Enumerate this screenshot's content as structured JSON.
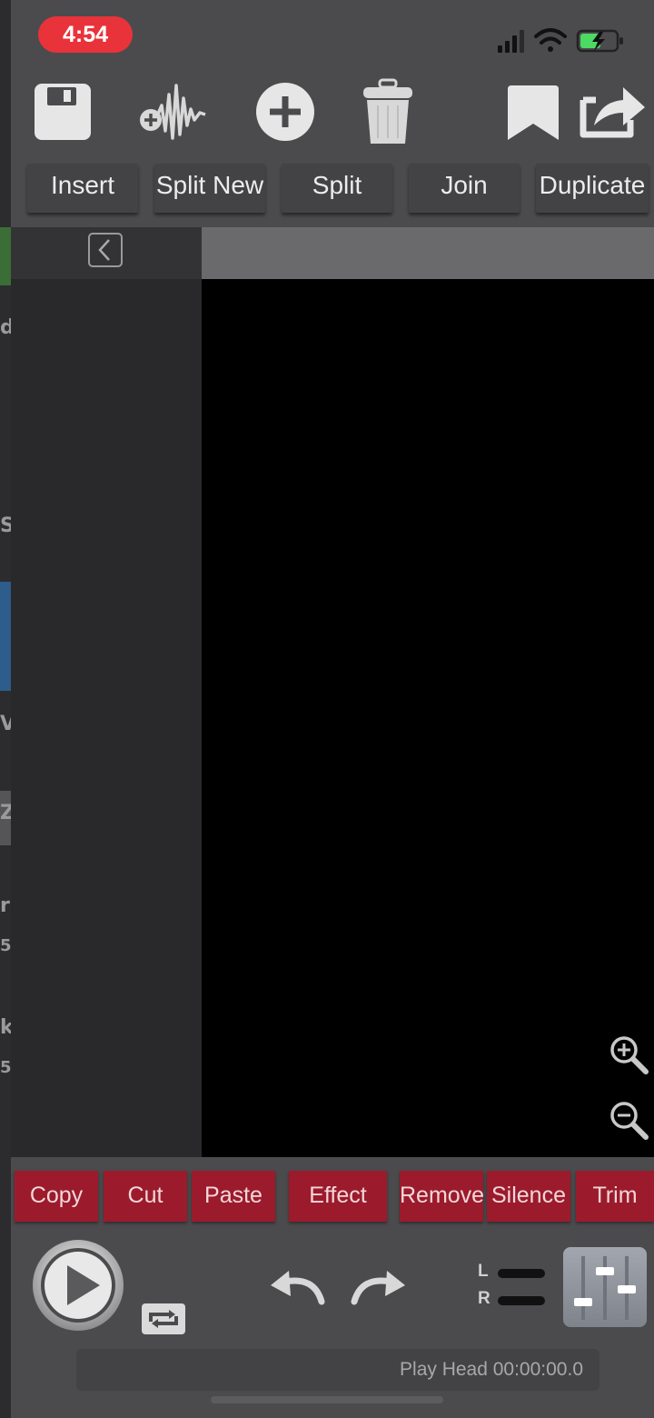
{
  "status_bar": {
    "time": "4:54"
  },
  "toolbar": {
    "icons": [
      "save-icon",
      "add-waveform-icon",
      "add-icon",
      "trash-icon",
      "bookmark-icon",
      "share-icon"
    ]
  },
  "tabs": [
    {
      "label": "Insert"
    },
    {
      "label": "Split New"
    },
    {
      "label": "Split"
    },
    {
      "label": "Join"
    },
    {
      "label": "Duplicate"
    }
  ],
  "edit_commands": [
    {
      "label": "Copy"
    },
    {
      "label": "Cut"
    },
    {
      "label": "Paste"
    },
    {
      "label": "Effect"
    },
    {
      "label": "Remove"
    },
    {
      "label": "Silence"
    },
    {
      "label": "Trim"
    }
  ],
  "transport": {
    "channel_left": "L",
    "channel_right": "R",
    "play_head": "Play Head 00:00:00.0"
  },
  "background_peek_glyphs": [
    "d",
    "S",
    "V",
    "Z",
    "r",
    "5",
    "k",
    "5"
  ],
  "colors": {
    "accent_red": "#9b1b2c",
    "time_pill": "#e8333b",
    "battery_green": "#4cd964"
  }
}
